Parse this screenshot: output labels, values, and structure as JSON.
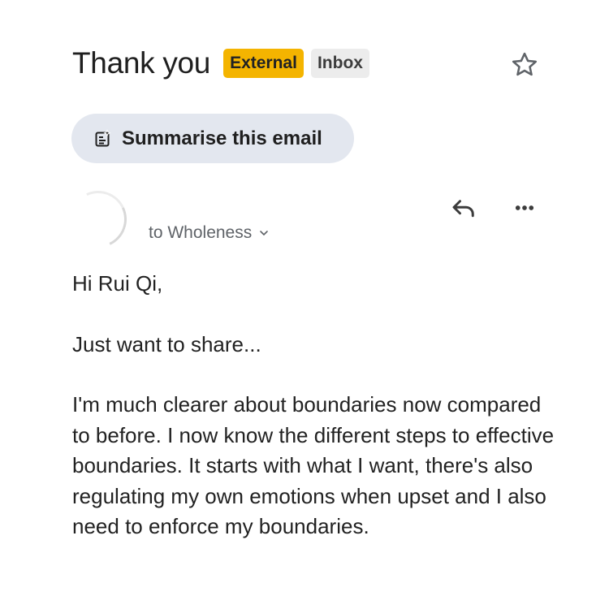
{
  "email": {
    "subject": "Thank you",
    "labels": {
      "external": "External",
      "inbox": "Inbox"
    },
    "summarise_label": "Summarise this email",
    "recipient_text": "to Wholeness",
    "body": {
      "greeting": "Hi Rui Qi,",
      "intro": "Just want to share...",
      "paragraph": "I'm much clearer about boundaries now compared to before. I now know the different steps to effective boundaries. It starts with what I want, there's also regulating my own emotions when upset and I also need to enforce my boundaries."
    }
  },
  "icons": {
    "star": "star-outline-icon",
    "summarise": "summarise-sparkle-icon",
    "reply": "reply-icon",
    "more": "more-horizontal-icon",
    "chevron": "chevron-down-icon"
  },
  "colors": {
    "external_label": "#f4b400",
    "inbox_label": "#ececec",
    "summarise_chip": "#e3e7ef",
    "text_primary": "#1f1f1f",
    "text_secondary": "#5f6368"
  }
}
